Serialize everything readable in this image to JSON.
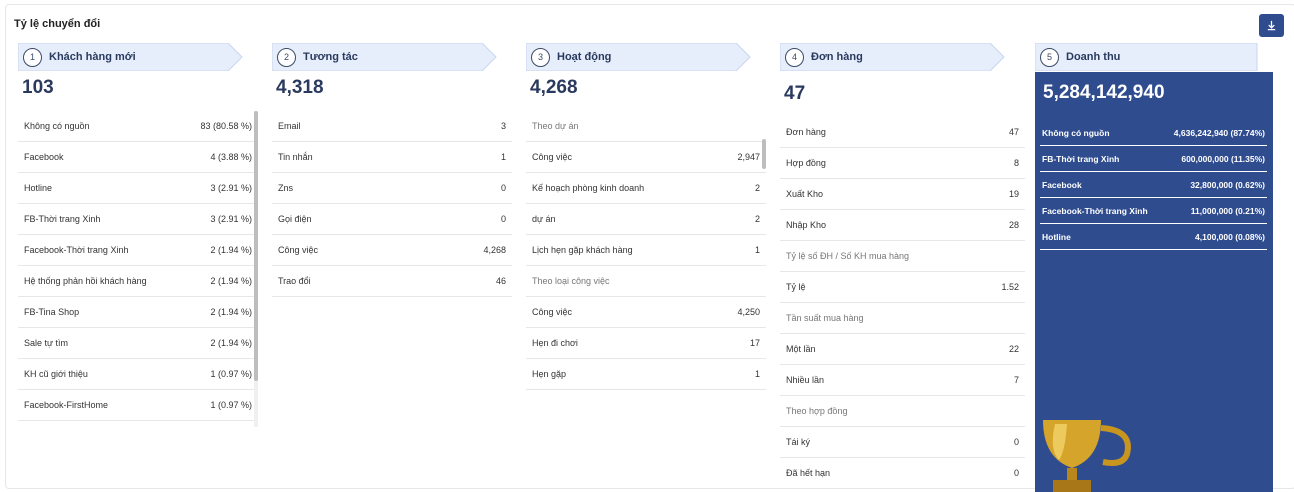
{
  "card": {
    "title": "Tỷ lệ chuyển đổi"
  },
  "colors": {
    "accent": "#2f4c8f",
    "header_bg": "#e6eefb",
    "trophy": "#d4a52a"
  },
  "icons": {
    "download": "download-icon",
    "trophy": "trophy-icon"
  },
  "steps": [
    {
      "num": "1",
      "label": "Khách hàng mới",
      "total": "103",
      "rows": [
        {
          "label": "Không có nguồn",
          "value": "83 (80.58 %)"
        },
        {
          "label": "Facebook",
          "value": "4 (3.88 %)"
        },
        {
          "label": "Hotline",
          "value": "3 (2.91 %)"
        },
        {
          "label": "FB-Thời trang Xinh",
          "value": "3 (2.91 %)"
        },
        {
          "label": "Facebook-Thời trang Xinh",
          "value": "2 (1.94 %)"
        },
        {
          "label": "Hệ thống phản hồi khách hàng",
          "value": "2 (1.94 %)"
        },
        {
          "label": "FB-Tina Shop",
          "value": "2 (1.94 %)"
        },
        {
          "label": "Sale tự tìm",
          "value": "2 (1.94 %)"
        },
        {
          "label": "KH cũ giới thiệu",
          "value": "1 (0.97 %)"
        },
        {
          "label": "Facebook-FirstHome",
          "value": "1 (0.97 %)"
        }
      ]
    },
    {
      "num": "2",
      "label": "Tương tác",
      "total": "4,318",
      "rows": [
        {
          "label": "Email",
          "value": "3"
        },
        {
          "label": "Tin nhắn",
          "value": "1"
        },
        {
          "label": "Zns",
          "value": "0"
        },
        {
          "label": "Gọi điện",
          "value": "0"
        },
        {
          "label": "Công việc",
          "value": "4,268"
        },
        {
          "label": "Trao đổi",
          "value": "46"
        }
      ]
    },
    {
      "num": "3",
      "label": "Hoạt động",
      "total": "4,268",
      "section1": "Theo dự án",
      "rows1": [
        {
          "label": "Công việc",
          "value": "2,947"
        },
        {
          "label": "Kế hoạch phòng kinh doanh",
          "value": "2"
        },
        {
          "label": "dự án",
          "value": "2"
        },
        {
          "label": "Lịch hẹn gặp khách hàng",
          "value": "1"
        }
      ],
      "section2": "Theo loại công việc",
      "rows2": [
        {
          "label": "Công việc",
          "value": "4,250"
        },
        {
          "label": "Hẹn đi chơi",
          "value": "17"
        },
        {
          "label": "Hẹn gặp",
          "value": "1"
        }
      ]
    },
    {
      "num": "4",
      "label": "Đơn hàng",
      "total": "47",
      "rows1": [
        {
          "label": "Đơn hàng",
          "value": "47"
        },
        {
          "label": "Hợp đồng",
          "value": "8"
        },
        {
          "label": "Xuất Kho",
          "value": "19"
        },
        {
          "label": "Nhập Kho",
          "value": "28"
        }
      ],
      "section1": "Tỷ lệ số ĐH / Số KH mua hàng",
      "rows2": [
        {
          "label": "Tỷ lệ",
          "value": "1.52"
        }
      ],
      "section2": "Tần suất mua hàng",
      "rows3": [
        {
          "label": "Một lần",
          "value": "22"
        },
        {
          "label": "Nhiều lần",
          "value": "7"
        }
      ],
      "section3": "Theo hợp đồng",
      "rows4": [
        {
          "label": "Tái ký",
          "value": "0"
        },
        {
          "label": "Đã hết hạn",
          "value": "0"
        }
      ]
    },
    {
      "num": "5",
      "label": "Doanh thu",
      "total": "5,284,142,940",
      "rows": [
        {
          "label": "Không có nguồn",
          "value": "4,636,242,940 (87.74%)"
        },
        {
          "label": "FB-Thời trang Xinh",
          "value": "600,000,000 (11.35%)"
        },
        {
          "label": "Facebook",
          "value": "32,800,000 (0.62%)"
        },
        {
          "label": "Facebook-Thời trang Xinh",
          "value": "11,000,000 (0.21%)"
        },
        {
          "label": "Hotline",
          "value": "4,100,000 (0.08%)"
        }
      ]
    }
  ]
}
